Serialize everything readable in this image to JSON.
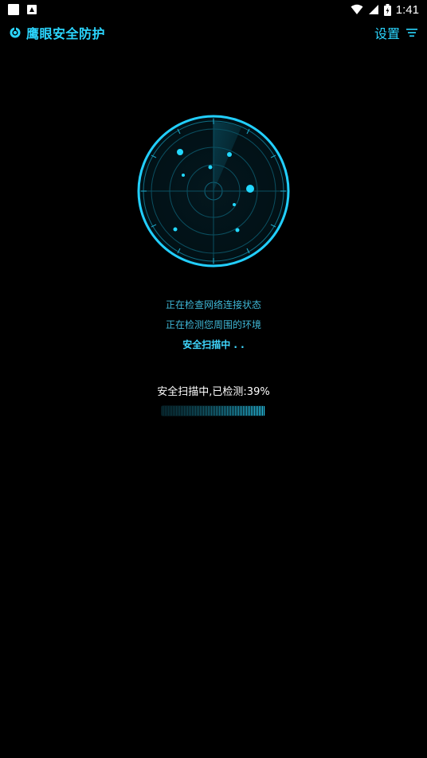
{
  "status_bar": {
    "time": "1:41"
  },
  "header": {
    "title": "鹰眼安全防护",
    "settings_label": "设置"
  },
  "scan": {
    "lines": [
      "正在检查网络连接状态",
      "正在检测您周围的环境",
      "安全扫描中 . ."
    ],
    "progress_text": "安全扫描中,已检测:39%",
    "progress": 0.39
  },
  "colors": {
    "accent": "#2bd6ff",
    "background": "#000000"
  }
}
